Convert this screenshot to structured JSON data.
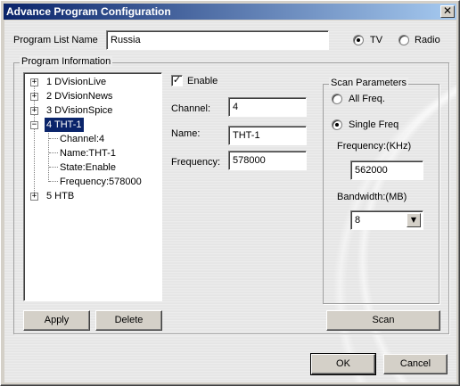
{
  "window": {
    "title": "Advance Program Configuration",
    "close_glyph": "✕"
  },
  "program_list": {
    "label": "Program List Name",
    "value": "Russia",
    "mode_options": [
      {
        "label": "TV",
        "checked": true
      },
      {
        "label": "Radio",
        "checked": false
      }
    ]
  },
  "program_info": {
    "group_title": "Program Information",
    "tree": [
      {
        "expander": "+",
        "label": "1   DVisionLive"
      },
      {
        "expander": "+",
        "label": "2   DVisionNews"
      },
      {
        "expander": "+",
        "label": "3   DVisionSpice"
      },
      {
        "expander": "−",
        "label": "4  THT-1",
        "selected": true
      },
      {
        "child": true,
        "label": "Channel:4"
      },
      {
        "child": true,
        "label": "Name:THT-1"
      },
      {
        "child": true,
        "label": "State:Enable"
      },
      {
        "child": true,
        "label": "Frequency:578000"
      },
      {
        "expander": "+",
        "label": "5   HTB"
      }
    ],
    "apply_button": "Apply",
    "delete_button": "Delete"
  },
  "details": {
    "enable_label": "Enable",
    "enable_checked": true,
    "check_glyph": "✓",
    "channel_label": "Channel:",
    "channel_value": "4",
    "name_label": "Name:",
    "name_value": "THT-1",
    "frequency_label": "Frequency:",
    "frequency_value": "578000"
  },
  "scan": {
    "group_title": "Scan Parameters",
    "all_freq_label": "All Freq.",
    "single_freq_label": "Single Freq",
    "all_freq_checked": false,
    "single_freq_checked": true,
    "frequency_label": "Frequency:(KHz)",
    "frequency_value": "562000",
    "bandwidth_label": "Bandwidth:(MB)",
    "bandwidth_value": "8",
    "combo_arrow_glyph": "▼",
    "scan_button": "Scan"
  },
  "footer": {
    "ok_button": "OK",
    "cancel_button": "Cancel"
  }
}
